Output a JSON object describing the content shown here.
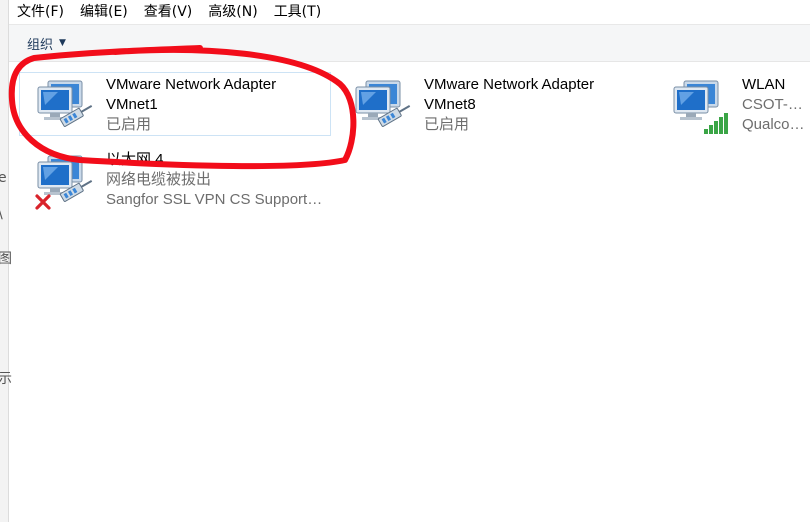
{
  "menu": {
    "items": [
      {
        "label": "文件(F)"
      },
      {
        "label": "编辑(E)"
      },
      {
        "label": "查看(V)"
      },
      {
        "label": "高级(N)"
      },
      {
        "label": "工具(T)"
      }
    ]
  },
  "toolbar": {
    "organize_label": "组织",
    "organize_caret": "▼"
  },
  "left_edge": {
    "glyphs": [
      "e",
      "\\",
      "图",
      "示"
    ]
  },
  "adapters": [
    {
      "name": "VMware Network Adapter",
      "line2": "VMnet1",
      "status": "已启用",
      "icon": "network-adapter-icon",
      "selected": true
    },
    {
      "name": "VMware Network Adapter",
      "line2": "VMnet8",
      "status": "已启用",
      "icon": "network-adapter-icon",
      "selected": false
    },
    {
      "name": "WLAN",
      "line2": "CSOT-Guest",
      "status": "Qualcomm",
      "icon": "wireless-adapter-icon",
      "selected": false
    },
    {
      "name": "以太网 4",
      "line2": "网络电缆被拔出",
      "status": "Sangfor SSL VPN CS Support S...",
      "icon": "disconnected-adapter-icon",
      "selected": false
    }
  ],
  "colors": {
    "annotation_red": "#f20d1a",
    "monitor_blue": "#1f6fc9",
    "signal_green": "#3aa546",
    "error_red": "#d9232b"
  }
}
